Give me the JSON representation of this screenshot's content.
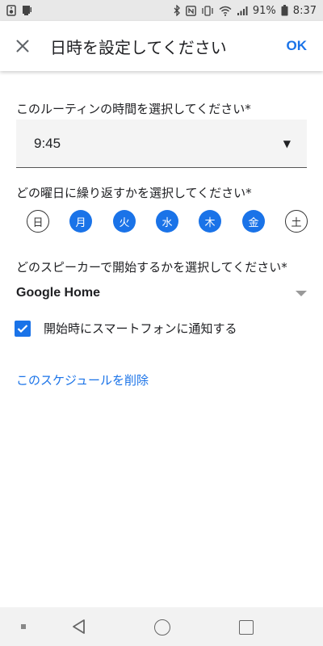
{
  "status_bar": {
    "battery": "91%",
    "time": "8:37"
  },
  "app_bar": {
    "title": "日時を設定してください",
    "ok_label": "OK"
  },
  "time_section": {
    "label": "このルーティンの時間を選択してください*",
    "value": "9:45"
  },
  "days_section": {
    "label": "どの曜日に繰り返すかを選択してください*",
    "days": [
      {
        "label": "日",
        "selected": false
      },
      {
        "label": "月",
        "selected": true
      },
      {
        "label": "火",
        "selected": true
      },
      {
        "label": "水",
        "selected": true
      },
      {
        "label": "木",
        "selected": true
      },
      {
        "label": "金",
        "selected": true
      },
      {
        "label": "土",
        "selected": false
      }
    ]
  },
  "speaker_section": {
    "label": "どのスピーカーで開始するかを選択してください*",
    "value": "Google Home"
  },
  "notify": {
    "label": "開始時にスマートフォンに通知する",
    "checked": true
  },
  "delete_link": "このスケジュールを削除",
  "colors": {
    "accent": "#1a73e8",
    "text": "#202124"
  }
}
